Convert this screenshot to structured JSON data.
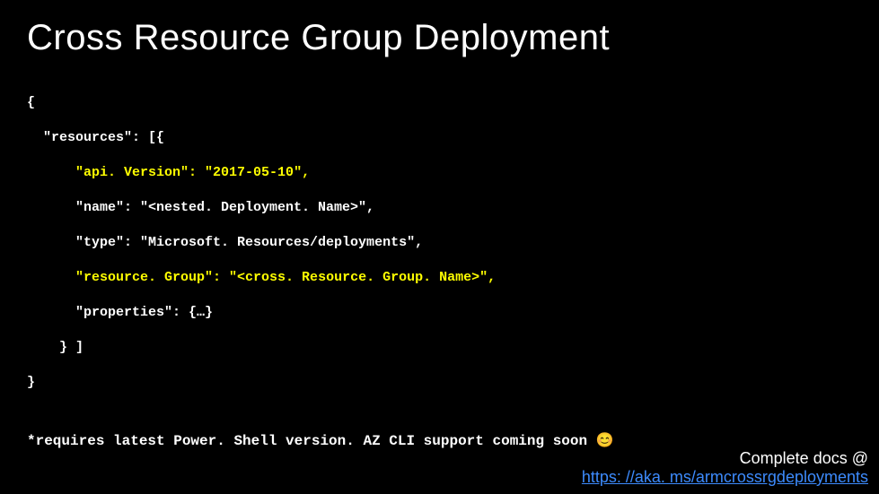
{
  "title": "Cross Resource Group Deployment",
  "code": {
    "open_brace": "{",
    "resources_key": "  \"resources\": [{",
    "api_version_key": "      \"api. Version\": ",
    "api_version_value": "\"2017-05-10\",",
    "name_line": "      \"name\": \"<nested. Deployment. Name>\",",
    "type_line": "      \"type\": \"Microsoft. Resources/deployments\",",
    "resource_group_key": "      \"resource. Group\": ",
    "resource_group_value": "\"<cross. Resource. Group. Name>\",",
    "properties_line": "      \"properties\": {…}",
    "close_inner": "    } ]",
    "close_brace": "}"
  },
  "note": "*requires latest Power. Shell version. AZ CLI support coming soon ",
  "note_emoji": "😊",
  "footer": {
    "label": "Complete docs @ ",
    "link_text": "https: //aka. ms/armcrossrgdeployments"
  }
}
